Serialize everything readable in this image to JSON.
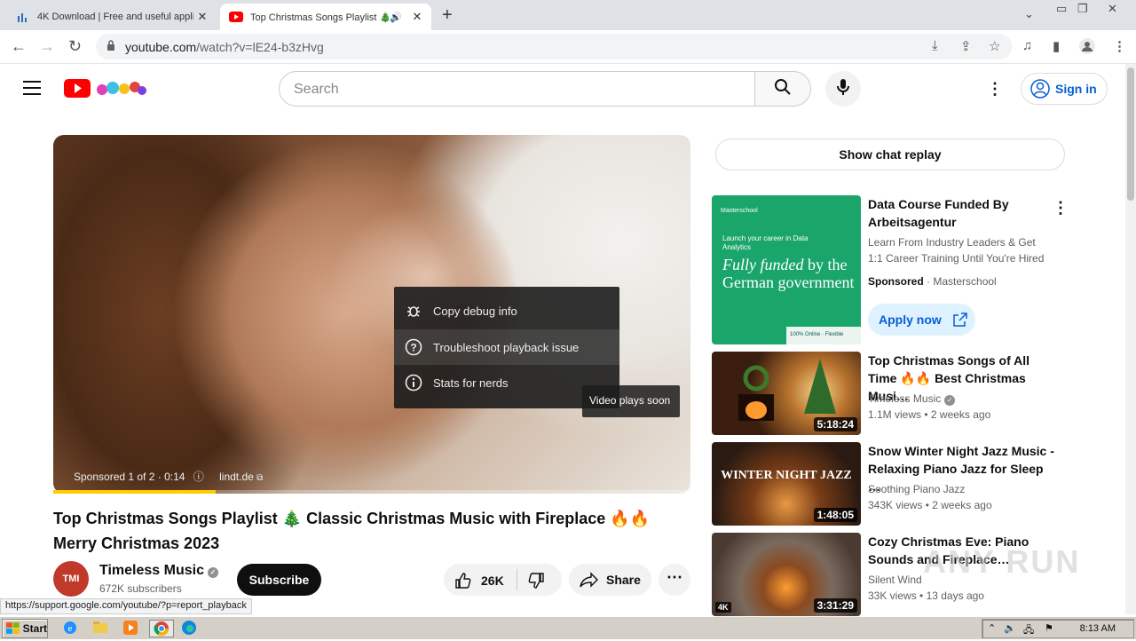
{
  "browser": {
    "tabs": [
      {
        "title": "4K Download | Free and useful applic",
        "active": false
      },
      {
        "title": "Top Christmas Songs Playlist 🎄",
        "active": true
      }
    ],
    "url_host": "youtube.com",
    "url_path": "/watch?v=lE24-b3zHvg",
    "status_url": "https://support.google.com/youtube/?p=report_playback"
  },
  "header": {
    "search_placeholder": "Search",
    "signin_label": "Sign in"
  },
  "player": {
    "context_menu": [
      {
        "label": "Copy debug info",
        "icon": "bug-icon"
      },
      {
        "label": "Troubleshoot playback issue",
        "icon": "question-circle-icon"
      },
      {
        "label": "Stats for nerds",
        "icon": "info-circle-icon"
      }
    ],
    "plays_soon": "Video plays soon",
    "sponsored_text": "Sponsored 1 of 2 · 0:14",
    "sponsor_link": "lindt.de",
    "progress_fraction": 0.255
  },
  "video": {
    "title": "Top Christmas Songs Playlist 🎄 Classic Christmas Music with Fireplace 🔥🔥 Merry Christmas 2023",
    "channel": "Timeless Music",
    "avatar_text": "TMI",
    "subscribers": "672K subscribers",
    "subscribe_label": "Subscribe",
    "likes": "26K",
    "share_label": "Share"
  },
  "sidebar": {
    "chat_replay": "Show chat replay",
    "ad": {
      "title": "Data Course Funded By Arbeitsagentur",
      "desc1": "Learn From Industry Leaders & Get",
      "desc2": "1:1 Career Training Until You're Hired",
      "sponsored": "Sponsored",
      "advertiser": "Masterschool",
      "cta": "Apply now",
      "thumb_brand": "Masterschool",
      "thumb_launch": "Launch your career in Data Analytics",
      "thumb_big1": "Fully funded",
      "thumb_big2": "by the German government",
      "thumb_foot": "100% Online · Flexible"
    },
    "videos": [
      {
        "title": "Top Christmas Songs of All Time 🔥🔥 Best Christmas Musi…",
        "channel": "Timeless Music",
        "verified": true,
        "views": "1.1M views",
        "age": "2 weeks ago",
        "duration": "5:18:24"
      },
      {
        "title": "Snow Winter Night Jazz Music - Relaxing Piano Jazz for Sleep …",
        "channel": "Soothing Piano Jazz",
        "verified": false,
        "views": "343K views",
        "age": "2 weeks ago",
        "duration": "1:48:05",
        "thumb_text": "WINTER NIGHT JAZZ"
      },
      {
        "title": "Cozy Christmas Eve: Piano Sounds and Fireplace…",
        "channel": "Silent Wind",
        "verified": false,
        "views": "33K views",
        "age": "13 days ago",
        "duration": "3:31:29",
        "badge": "4K"
      }
    ]
  },
  "watermark": "ANY RUN",
  "taskbar": {
    "start_label": "Start",
    "clock": "8:13 AM"
  }
}
